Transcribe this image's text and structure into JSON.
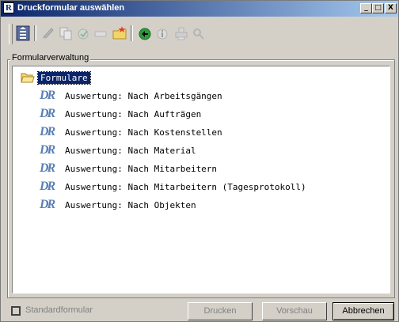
{
  "window": {
    "title": "Druckformular auswählen",
    "app_icon_glyph": "R",
    "controls": {
      "minimize": "_",
      "maximize": "□",
      "close": "X"
    }
  },
  "toolbar": {
    "icons": [
      "properties-icon",
      "rename-icon",
      "copy-icon",
      "edit-icon",
      "delete-icon",
      "new-folder-icon",
      "import-icon",
      "info-icon",
      "print-setup-icon",
      "search-icon"
    ]
  },
  "groupbox": {
    "label": "Formularverwaltung"
  },
  "tree": {
    "root": "Formulare",
    "items": [
      "Auswertung: Nach Arbeitsgängen",
      "Auswertung: Nach Aufträgen",
      "Auswertung: Nach Kostenstellen",
      "Auswertung: Nach Material",
      "Auswertung: Nach Mitarbeitern",
      "Auswertung: Nach Mitarbeitern (Tagesprotokoll)",
      "Auswertung: Nach Objekten"
    ],
    "item_icon_text": "DR"
  },
  "footer": {
    "standard_checkbox_label": "Standardformular",
    "print_button": "Drucken",
    "preview_button": "Vorschau",
    "cancel_button": "Abbrechen"
  },
  "colors": {
    "titlebar_start": "#0a246a",
    "titlebar_end": "#a6caf0",
    "selection": "#0a246a",
    "face": "#d4d0c8"
  }
}
